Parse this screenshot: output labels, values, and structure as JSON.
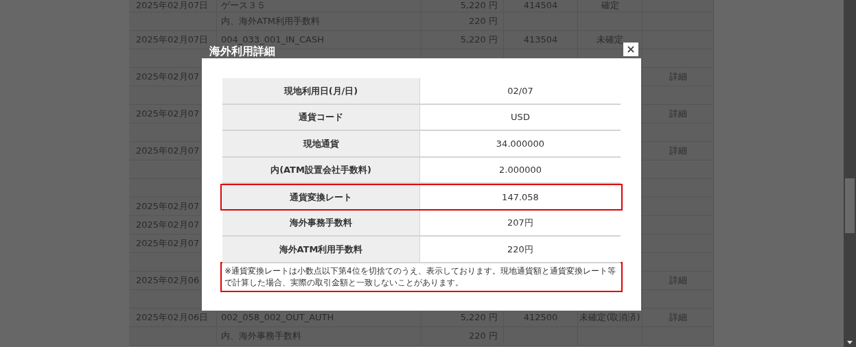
{
  "table": {
    "rows": [
      {
        "date": "2025年02月07日",
        "description": "ゲース３５",
        "amount": "5,220 円",
        "number": "414504",
        "status": "確定",
        "detail": ""
      },
      {
        "date": "",
        "description": "内、海外ATM利用手数料",
        "amount": "220 円",
        "number": "",
        "status": "",
        "detail": ""
      },
      {
        "date": "2025年02月07日",
        "description": "004_033_001_IN_CASH",
        "amount": "5,220 円",
        "number": "413504",
        "status": "未確定",
        "detail": ""
      },
      {
        "date": "",
        "description": "",
        "amount": "",
        "number": "",
        "status": "",
        "detail": ""
      },
      {
        "date": "2025年02月07",
        "description": "",
        "amount": "",
        "number": "",
        "status": "",
        "detail": "詳細"
      },
      {
        "date": "",
        "description": "",
        "amount": "",
        "number": "",
        "status": "",
        "detail": ""
      },
      {
        "date": "2025年02月07",
        "description": "",
        "amount": "",
        "number": "",
        "status": "",
        "detail": "詳細"
      },
      {
        "date": "",
        "description": "",
        "amount": "",
        "number": "",
        "status": "",
        "detail": ""
      },
      {
        "date": "2025年02月07",
        "description": "",
        "amount": "",
        "number": "",
        "status": "",
        "detail": "詳細"
      },
      {
        "date": "",
        "description": "",
        "amount": "",
        "number": "",
        "status": "",
        "detail": ""
      },
      {
        "date": "",
        "description": "",
        "amount": "",
        "number": "",
        "status": "",
        "detail": ""
      },
      {
        "date": "2025年02月07",
        "description": "",
        "amount": "",
        "number": "",
        "status": "",
        "detail": ""
      },
      {
        "date": "2025年02月07",
        "description": "",
        "amount": "",
        "number": "",
        "status": "",
        "detail": ""
      },
      {
        "date": "2025年02月07",
        "description": "",
        "amount": "",
        "number": "",
        "status": "",
        "detail": ""
      },
      {
        "date": "",
        "description": "",
        "amount": "",
        "number": "",
        "status": "",
        "detail": ""
      },
      {
        "date": "2025年02月06",
        "description": "",
        "amount": "",
        "number": "",
        "status": "",
        "detail": "詳細"
      },
      {
        "date": "",
        "description": "",
        "amount": "",
        "number": "",
        "status": "",
        "detail": ""
      },
      {
        "date": "2025年02月06日",
        "description": "002_058_002_OUT_AUTH",
        "amount": "5,220 円",
        "number": "412500",
        "status": "未確定(取消済)",
        "detail": "詳細"
      },
      {
        "date": "",
        "description": "内、海外事務手数料",
        "amount": "220 円",
        "number": "",
        "status": "",
        "detail": ""
      }
    ]
  },
  "dialog": {
    "title": "海外利用詳細",
    "close": "×",
    "rows": [
      {
        "label": "現地利用日(月/日)",
        "value": "02/07",
        "highlighted": false
      },
      {
        "label": "通貨コード",
        "value": "USD",
        "highlighted": false
      },
      {
        "label": "現地通貨",
        "value": "34.000000",
        "highlighted": false
      },
      {
        "label": "内(ATM設置会社手数料)",
        "value": "2.000000",
        "highlighted": false
      },
      {
        "label": "通貨変換レート",
        "value": "147.058",
        "highlighted": true
      },
      {
        "label": "海外事務手数料",
        "value": "207円",
        "highlighted": false
      },
      {
        "label": "海外ATM利用手数料",
        "value": "220円",
        "highlighted": false
      }
    ],
    "note": {
      "text": "※通貨変換レートは小数点以下第4位を切捨てのうえ、表示しております。現地通貨額と通貨変換レート等で計算した場合、実際の取引金額と一致しないことがあります。",
      "highlighted": true
    }
  }
}
